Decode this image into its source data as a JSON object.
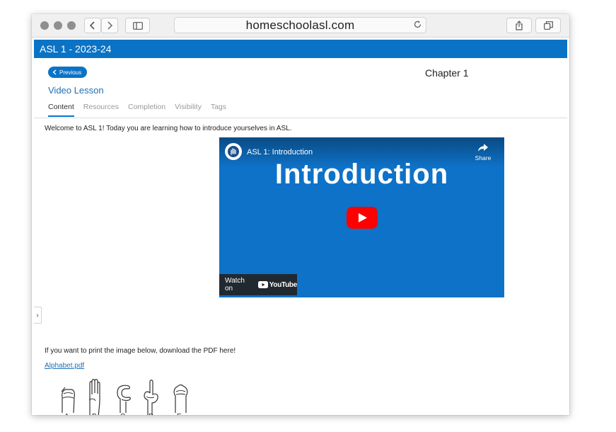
{
  "browser": {
    "url": "homeschoolasl.com",
    "icons": [
      "back-icon",
      "forward-icon",
      "sidebar-icon",
      "reload-icon",
      "share-icon",
      "tabs-icon"
    ]
  },
  "course": {
    "title": "ASL 1 - 2023-24"
  },
  "nav": {
    "previous_label": "Previous",
    "chapter": "Chapter 1"
  },
  "lesson": {
    "title": "Video Lesson",
    "tabs": [
      {
        "label": "Content",
        "active": true
      },
      {
        "label": "Resources",
        "active": false
      },
      {
        "label": "Completion",
        "active": false
      },
      {
        "label": "Visibility",
        "active": false
      },
      {
        "label": "Tags",
        "active": false
      }
    ],
    "welcome_text": "Welcome to ASL 1!  Today you are learning how to introduce yourselves in ASL."
  },
  "video": {
    "channel_title": "ASL 1: Introduction",
    "big_title": "Introduction",
    "share_label": "Share",
    "watch_on": "Watch on",
    "youtube_label": "YouTube",
    "background_color": "#0e72c8",
    "play_color": "#ff0000"
  },
  "content": {
    "print_text": "If you want to print the image below, download the PDF here!",
    "pdf_link": "Alphabet.pdf",
    "alphabet_letters": [
      "A",
      "B",
      "C",
      "D",
      "E"
    ]
  },
  "colors": {
    "accent": "#0b73c5",
    "link": "#1f6fb5"
  }
}
